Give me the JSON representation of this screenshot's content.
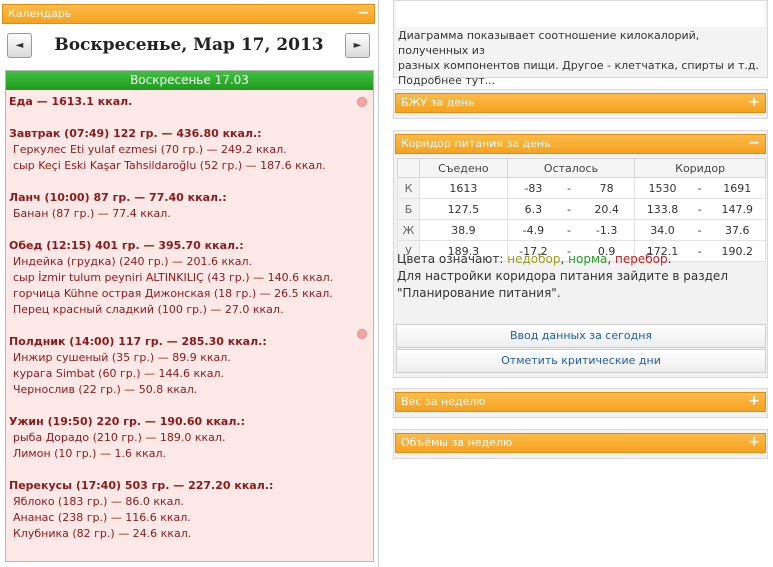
{
  "calendar": {
    "header": "Календарь",
    "toggle": "−",
    "prev": "◄",
    "next": "►",
    "title": "Воскресенье, Мар 17, 2013",
    "day_header": "Воскресенье 17.03",
    "total": "Еда — 1613.1 ккал.",
    "meals": [
      {
        "title": "Завтрак (07:49) 122 гр. — 436.80 ккал.:",
        "items": [
          "Геркулес Eti yulaf ezmesi (70 гр.) — 249.2 ккал.",
          "сыр Keçi Eski Kaşar Tahsildaroğlu (52 гр.) — 187.6 ккал."
        ]
      },
      {
        "title": "Ланч (10:00) 87 гр. — 77.40 ккал.:",
        "items": [
          "Банан (87 гр.) — 77.4 ккал."
        ]
      },
      {
        "title": "Обед (12:15) 401 гр. — 395.70 ккал.:",
        "items": [
          "Индейка (грудка) (240 гр.) — 201.6 ккал.",
          "сыр İzmir tulum peyniri ALTINKILIÇ (43 гр.) — 140.6 ккал.",
          "горчица Kühne острая Дижонская (18 гр.) — 26.5 ккал.",
          "Перец красный сладкий (100 гр.) — 27.0 ккал."
        ]
      },
      {
        "title": "Полдник (14:00) 117 гр. — 285.30 ккал.:",
        "items": [
          "Инжир сушеный (35 гр.) — 89.9 ккал.",
          "курага Simbat (60 гр.) — 144.6 ккал.",
          "Чернослив (22 гр.) — 50.8 ккал."
        ]
      },
      {
        "title": "Ужин (19:50) 220 гр. — 190.60 ккал.:",
        "items": [
          "рыба Дорадо (210 гр.) — 189.0 ккал.",
          "Лимон (10 гр.) — 1.6 ккал."
        ]
      },
      {
        "title": "Перекусы (17:40) 503 гр. — 227.20 ккал.:",
        "items": [
          "Яблоко (183 гр.) — 86.0 ккал.",
          "Ананас (238 гр.) — 116.6 ккал.",
          "Клубника (82 гр.) — 24.6 ккал."
        ]
      }
    ]
  },
  "info": {
    "line1": "Диаграмма показывает соотношение килокалорий, полученных из",
    "line2": "разных компонентов пищи. Другое - клетчатка, спирты и т.д.",
    "line3": "Подробнее тут..."
  },
  "panels": {
    "bju": {
      "title": "БЖУ за день",
      "toggle": "+"
    },
    "corridor": {
      "title": "Коридор питания за день",
      "toggle": "−"
    },
    "weight": {
      "title": "Вес за неделю",
      "toggle": "+"
    },
    "volumes": {
      "title": "Объёмы за неделю",
      "toggle": "+"
    }
  },
  "corridor_table": {
    "headers": {
      "eaten": "Съедено",
      "left": "Осталось",
      "range": "Коридор"
    },
    "dash": "-",
    "rows": [
      {
        "label": "К",
        "eaten": "1613",
        "left_min": "-83",
        "left_max": "78",
        "min": "1530",
        "max": "1691",
        "status_color": "#2a9a2a"
      },
      {
        "label": "Б",
        "eaten": "127.5",
        "left_min": "6.3",
        "left_max": "20.4",
        "min": "133.8",
        "max": "147.9",
        "status_color": "#9a9a1a"
      },
      {
        "label": "Ж",
        "eaten": "38.9",
        "left_min": "-4.9",
        "left_max": "-1.3",
        "min": "34.0",
        "max": "37.6",
        "status_color": "#c21c1c"
      },
      {
        "label": "У",
        "eaten": "189.3",
        "left_min": "-17.2",
        "left_max": "0.9",
        "min": "172.1",
        "max": "190.2",
        "status_color": "#2a9a2a"
      }
    ],
    "legend_prefix": "Цвета означают:",
    "legend_under": "недобор",
    "legend_norm": "норма",
    "legend_over": "перебор",
    "hint_line1": "Для настройки коридора питания зайдите в раздел",
    "hint_line2": "\"Планирование питания\".",
    "btn_today": "Ввод данных за сегодня",
    "btn_critical": "Отметить критические дни"
  }
}
